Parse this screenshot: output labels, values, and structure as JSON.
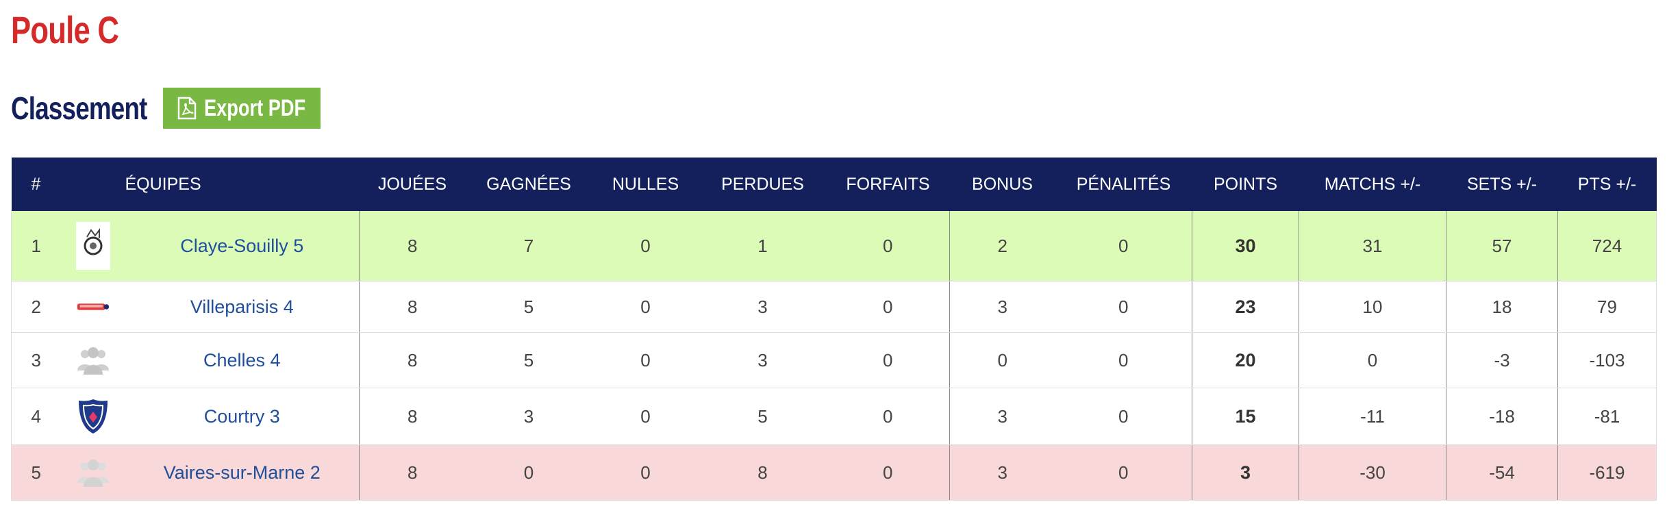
{
  "pool": {
    "title": "Poule C"
  },
  "standings": {
    "title": "Classement",
    "export_label": "Export PDF"
  },
  "table": {
    "headers": {
      "rank": "#",
      "team": "ÉQUIPES",
      "played": "JOUÉES",
      "won": "GAGNÉES",
      "drawn": "NULLES",
      "lost": "PERDUES",
      "forfeits": "FORFAITS",
      "bonus": "BONUS",
      "penalties": "PÉNALITÉS",
      "points": "POINTS",
      "matches_diff": "MATCHS +/-",
      "sets_diff": "SETS +/-",
      "pts_diff": "PTS +/-"
    },
    "rows": [
      {
        "rank": "1",
        "logo": "club-crest-icon",
        "team": "Claye-Souilly 5",
        "played": "8",
        "won": "7",
        "drawn": "0",
        "lost": "1",
        "forfeits": "0",
        "bonus": "2",
        "penalties": "0",
        "points": "30",
        "matches_diff": "31",
        "sets_diff": "57",
        "pts_diff": "724"
      },
      {
        "rank": "2",
        "logo": "club-banner-icon",
        "team": "Villeparisis 4",
        "played": "8",
        "won": "5",
        "drawn": "0",
        "lost": "3",
        "forfeits": "0",
        "bonus": "3",
        "penalties": "0",
        "points": "23",
        "matches_diff": "10",
        "sets_diff": "18",
        "pts_diff": "79"
      },
      {
        "rank": "3",
        "logo": "group-placeholder-icon",
        "team": "Chelles 4",
        "played": "8",
        "won": "5",
        "drawn": "0",
        "lost": "3",
        "forfeits": "0",
        "bonus": "0",
        "penalties": "0",
        "points": "20",
        "matches_diff": "0",
        "sets_diff": "-3",
        "pts_diff": "-103"
      },
      {
        "rank": "4",
        "logo": "shield-crest-icon",
        "team": "Courtry 3",
        "played": "8",
        "won": "3",
        "drawn": "0",
        "lost": "5",
        "forfeits": "0",
        "bonus": "3",
        "penalties": "0",
        "points": "15",
        "matches_diff": "-11",
        "sets_diff": "-18",
        "pts_diff": "-81"
      },
      {
        "rank": "5",
        "logo": "group-placeholder-icon",
        "team": "Vaires-sur-Marne 2",
        "played": "8",
        "won": "0",
        "drawn": "0",
        "lost": "8",
        "forfeits": "0",
        "bonus": "3",
        "penalties": "0",
        "points": "3",
        "matches_diff": "-30",
        "sets_diff": "-54",
        "pts_diff": "-619"
      }
    ]
  },
  "colors": {
    "pool_title": "#d62a2a",
    "header_bg": "#13205c",
    "export_bg": "#79b842",
    "leader_row_bg": "#dcfbb7",
    "last_row_bg": "#f8d8d8",
    "team_link": "#1f4f9c"
  }
}
